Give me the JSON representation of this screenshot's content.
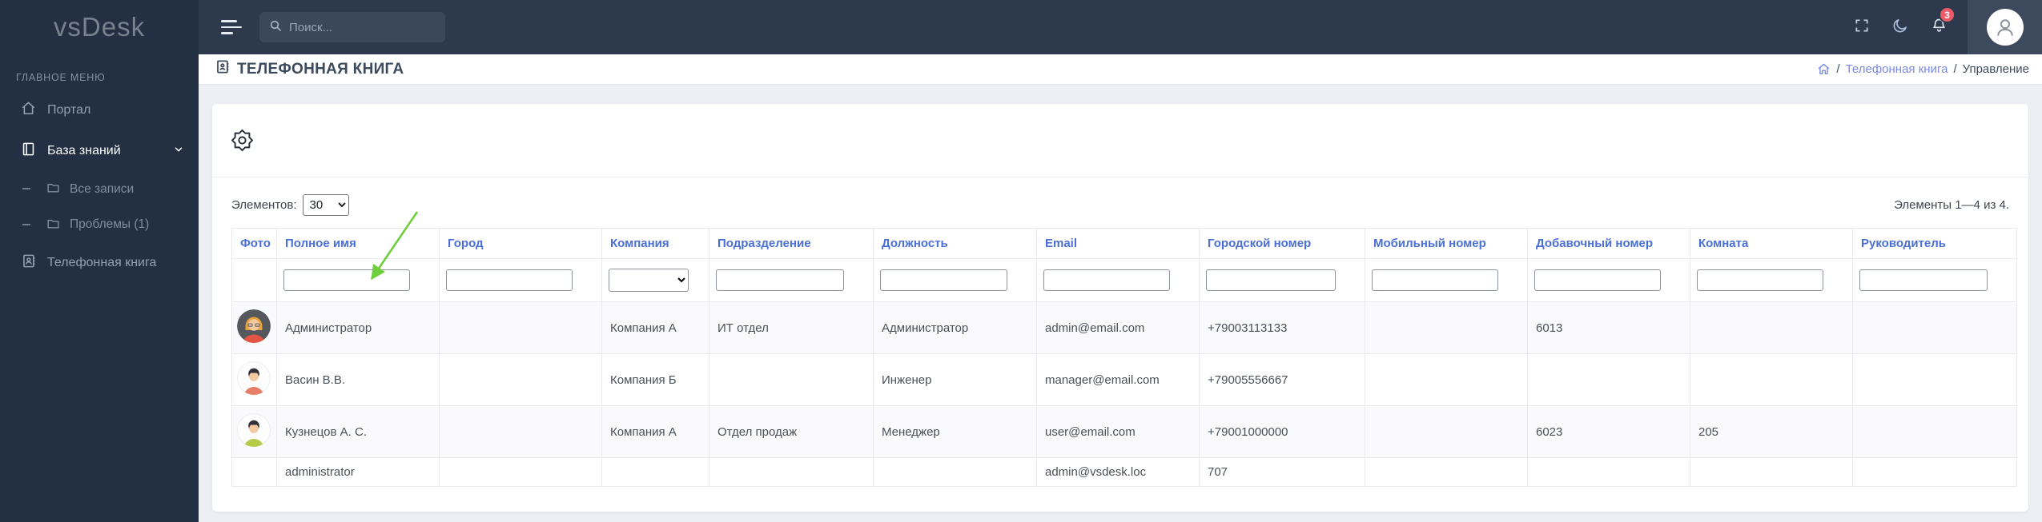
{
  "colors": {
    "sidebar_bg": "#232f43",
    "topbar_bg": "#2d3a4e",
    "accent_blue": "#4a6fd6",
    "link_blue": "#7a8ae2",
    "badge_red": "#ee5a68",
    "arrow_green": "#6fce3e",
    "page_bg": "#edeff5"
  },
  "sidebar": {
    "logo": "vsDesk",
    "section_label": "ГЛАВНОЕ МЕНЮ",
    "items": [
      {
        "label": "Портал",
        "icon": "home-icon"
      },
      {
        "label": "База знаний",
        "icon": "book-icon"
      },
      {
        "label": "Все записи",
        "icon": "folder-icon"
      },
      {
        "label": "Проблемы (1)",
        "icon": "folder-icon"
      },
      {
        "label": "Телефонная книга",
        "icon": "address-book-icon"
      }
    ]
  },
  "topbar": {
    "search_placeholder": "Поиск...",
    "notification_count": "3"
  },
  "page": {
    "title": "ТЕЛЕФОННАЯ КНИГА",
    "breadcrumb": {
      "separator": "/",
      "link": "Телефонная книга",
      "current": "Управление"
    }
  },
  "toolbar": {
    "items_label": "Элементов:",
    "per_page": "30",
    "range_text": "Элементы 1—4 из 4."
  },
  "table": {
    "columns": [
      "Фото",
      "Полное имя",
      "Город",
      "Компания",
      "Подразделение",
      "Должность",
      "Email",
      "Городской номер",
      "Мобильный номер",
      "Добавочный номер",
      "Комната",
      "Руководитель"
    ],
    "rows": [
      {
        "avatar": "avatar-female-red",
        "cells": [
          "Администратор",
          "",
          "Компания А",
          "ИТ отдел",
          "Администратор",
          "admin@email.com",
          "+79003113133",
          "",
          "6013",
          "",
          ""
        ]
      },
      {
        "avatar": "avatar-male-salmon",
        "cells": [
          "Васин В.В.",
          "",
          "Компания Б",
          "",
          "Инженер",
          "manager@email.com",
          "+79005556667",
          "",
          "",
          "",
          ""
        ]
      },
      {
        "avatar": "avatar-male-green",
        "cells": [
          "Кузнецов А. С.",
          "",
          "Компания А",
          "Отдел продаж",
          "Менеджер",
          "user@email.com",
          "+79001000000",
          "",
          "6023",
          "205",
          ""
        ]
      },
      {
        "avatar": "",
        "cells": [
          "administrator",
          "",
          "",
          "",
          "",
          "admin@vsdesk.loc",
          "707",
          "",
          "",
          "",
          ""
        ]
      }
    ]
  }
}
